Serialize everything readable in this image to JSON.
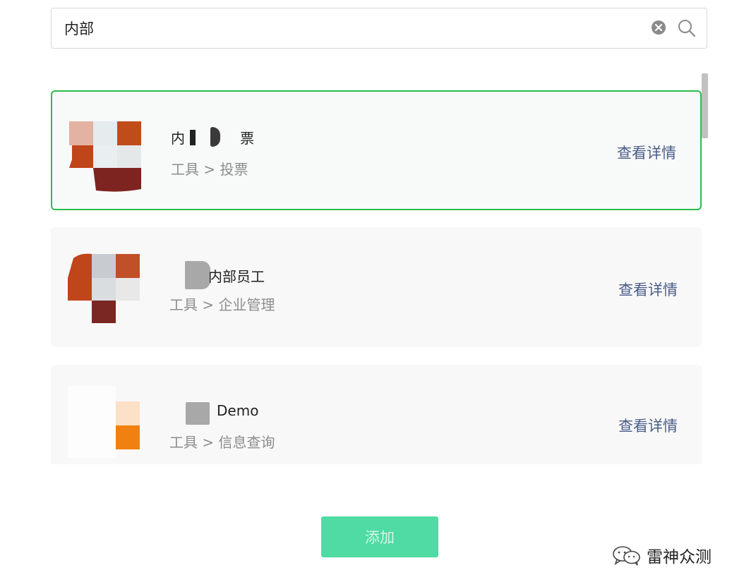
{
  "search": {
    "value": "内部",
    "icon_clear": "clear-circle-icon",
    "icon_search": "magnifier-icon"
  },
  "results": [
    {
      "title": "内部投票",
      "title_visible_prefix": "内",
      "title_visible_suffix": "票",
      "breadcrumb": "工具 > 投票",
      "link": "查看详情",
      "selected": true
    },
    {
      "title": "内部员工",
      "breadcrumb": "工具 > 企业管理",
      "link": "查看详情",
      "selected": false
    },
    {
      "title": "Demo",
      "breadcrumb": "工具 > 信息查询",
      "link": "查看详情",
      "selected": false
    }
  ],
  "add_button": {
    "label": "添加",
    "state": "disabled"
  },
  "watermark": {
    "text": "雷神众测",
    "icon": "wechat-icon"
  },
  "colors": {
    "selected_border": "#2bbd4a",
    "link": "#4a5d88",
    "button_bg": "#4fdba3",
    "card_bg": "#f8f8f8"
  }
}
